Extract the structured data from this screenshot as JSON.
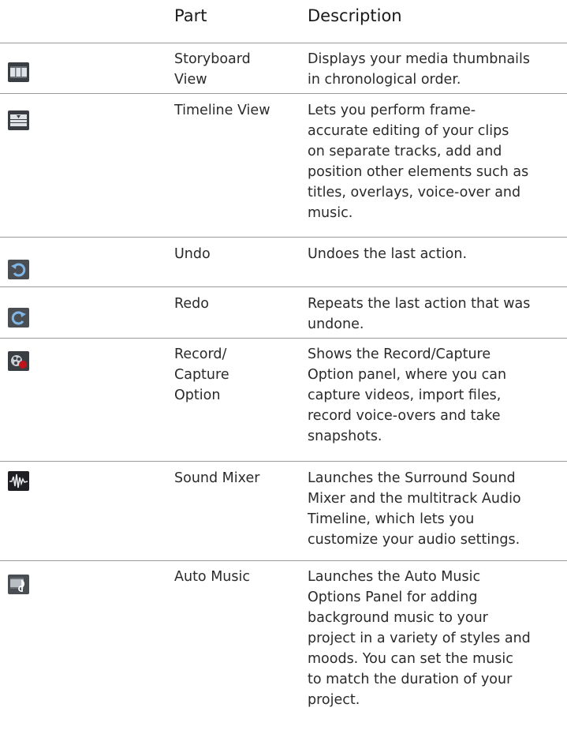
{
  "header": {
    "part": "Part",
    "description": "Description"
  },
  "rows": [
    {
      "icon": "storyboard-view-icon",
      "part": "Storyboard\nView",
      "description": "Displays your media thumbnails\nin chronological order."
    },
    {
      "icon": "timeline-view-icon",
      "part": "Timeline View",
      "description": "Lets you perform frame-\naccurate editing of your clips\non separate tracks, add and\nposition other elements such as\ntitles, overlays, voice-over and\nmusic."
    },
    {
      "icon": "undo-icon",
      "part": "Undo",
      "description": "Undoes the last action."
    },
    {
      "icon": "redo-icon",
      "part": "Redo",
      "description": "Repeats the last action that was\nundone."
    },
    {
      "icon": "record-capture-icon",
      "part": "Record/\nCapture\nOption",
      "description": "Shows the Record/Capture\nOption panel, where you can\ncapture videos, import files,\nrecord voice-overs and take\nsnapshots."
    },
    {
      "icon": "sound-mixer-icon",
      "part": "Sound Mixer",
      "description": "Launches the Surround Sound\nMixer and the multitrack Audio\nTimeline, which lets you\ncustomize your audio settings."
    },
    {
      "icon": "auto-music-icon",
      "part": "Auto Music",
      "description": "Launches the Auto Music\nOptions Panel for adding\nbackground music to your\nproject in a variety of styles and\nmoods. You can set the music\nto match the duration of your\nproject."
    }
  ]
}
